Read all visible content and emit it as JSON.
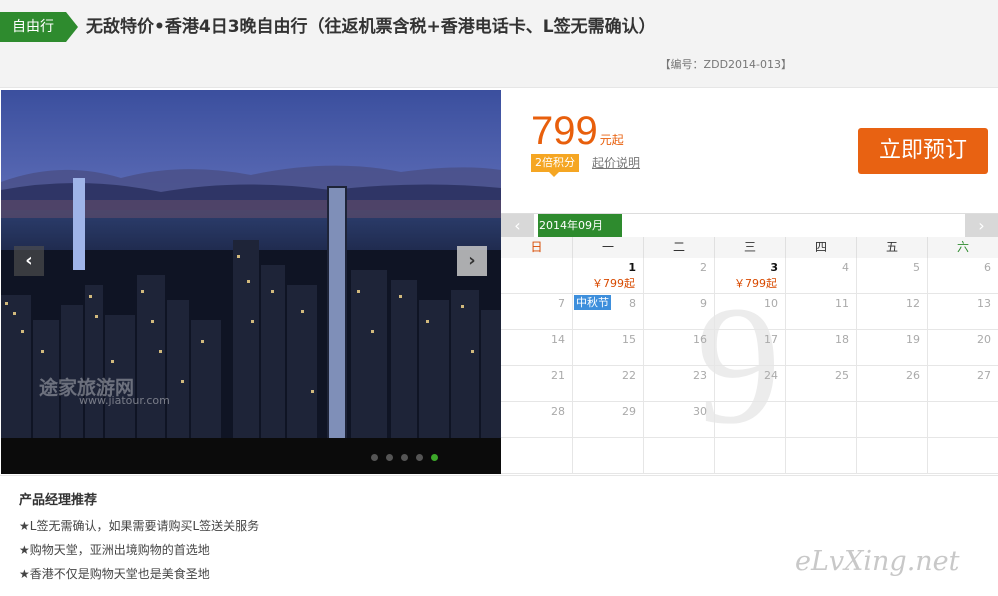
{
  "header": {
    "tag": "自由行",
    "title": "无敌特价•香港4日3晚自由行（往返机票含税+香港电话卡、L签无需确认）",
    "code": "【编号：ZDD2014-013】"
  },
  "gallery": {
    "watermark": "途家旅游网",
    "watermark_url": "www.jiatour.com",
    "prev_icon": "chevron-left-icon",
    "next_icon": "chevron-right-icon",
    "slide_count": 5,
    "active_slide": 5
  },
  "pricing": {
    "price": "799",
    "unit": "元起",
    "points_badge": "2倍积分",
    "price_note": "起价说明",
    "book_button": "立即预订",
    "accent_color": "#e85f0c"
  },
  "calendar": {
    "month_label": "2014年09月",
    "watermark_month": "9",
    "weekdays": [
      "日",
      "一",
      "二",
      "三",
      "四",
      "五",
      "六"
    ],
    "price_label": "￥799起",
    "holiday_label": "中秋节",
    "days": [
      {
        "d": "1",
        "avail": true
      },
      {
        "d": "2",
        "avail": false
      },
      {
        "d": "3",
        "avail": true
      },
      {
        "d": "4",
        "avail": false
      },
      {
        "d": "5",
        "avail": false
      },
      {
        "d": "6",
        "avail": false
      },
      {
        "d": "7",
        "avail": false
      },
      {
        "d": "8",
        "avail": false
      },
      {
        "d": "9",
        "avail": false
      },
      {
        "d": "10",
        "avail": false
      },
      {
        "d": "11",
        "avail": false
      },
      {
        "d": "12",
        "avail": false
      },
      {
        "d": "13",
        "avail": false
      },
      {
        "d": "14",
        "avail": false
      },
      {
        "d": "15",
        "avail": false
      },
      {
        "d": "16",
        "avail": false
      },
      {
        "d": "17",
        "avail": false
      },
      {
        "d": "18",
        "avail": false
      },
      {
        "d": "19",
        "avail": false
      },
      {
        "d": "20",
        "avail": false
      },
      {
        "d": "21",
        "avail": false
      },
      {
        "d": "22",
        "avail": false
      },
      {
        "d": "23",
        "avail": false
      },
      {
        "d": "24",
        "avail": false
      },
      {
        "d": "25",
        "avail": false
      },
      {
        "d": "26",
        "avail": false
      },
      {
        "d": "27",
        "avail": false
      },
      {
        "d": "28",
        "avail": false
      },
      {
        "d": "29",
        "avail": false
      },
      {
        "d": "30",
        "avail": false
      }
    ]
  },
  "recommend": {
    "title": "产品经理推荐",
    "items": [
      "★L签无需确认，如果需要请购买L签送关服务",
      "★购物天堂，亚洲出境购物的首选地",
      "★香港不仅是购物天堂也是美食圣地"
    ]
  },
  "site_watermark": "eLvXing.net"
}
